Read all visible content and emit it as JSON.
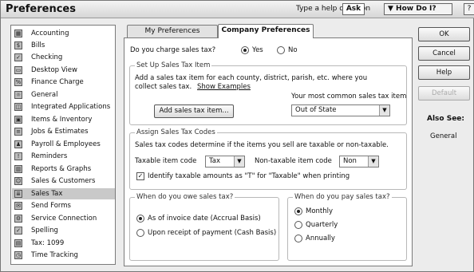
{
  "window": {
    "title": "Preferences",
    "help_question": "Type a help question",
    "ask_label": "Ask",
    "how_do_i_label": "▼ How Do I?",
    "close_label": "?"
  },
  "sidebar": {
    "items": [
      {
        "label": "Accounting",
        "icon": "accounting-icon",
        "selected": false
      },
      {
        "label": "Bills",
        "icon": "bills-icon",
        "selected": false
      },
      {
        "label": "Checking",
        "icon": "checking-icon",
        "selected": false
      },
      {
        "label": "Desktop View",
        "icon": "desktop-view-icon",
        "selected": false
      },
      {
        "label": "Finance Charge",
        "icon": "finance-charge-icon",
        "selected": false
      },
      {
        "label": "General",
        "icon": "general-icon",
        "selected": false
      },
      {
        "label": "Integrated Applications",
        "icon": "integrated-applications-icon",
        "selected": false
      },
      {
        "label": "Items & Inventory",
        "icon": "items-inventory-icon",
        "selected": false
      },
      {
        "label": "Jobs & Estimates",
        "icon": "jobs-estimates-icon",
        "selected": false
      },
      {
        "label": "Payroll & Employees",
        "icon": "payroll-employees-icon",
        "selected": false
      },
      {
        "label": "Reminders",
        "icon": "reminders-icon",
        "selected": false
      },
      {
        "label": "Reports & Graphs",
        "icon": "reports-graphs-icon",
        "selected": false
      },
      {
        "label": "Sales & Customers",
        "icon": "sales-customers-icon",
        "selected": false
      },
      {
        "label": "Sales Tax",
        "icon": "sales-tax-icon",
        "selected": true
      },
      {
        "label": "Send Forms",
        "icon": "send-forms-icon",
        "selected": false
      },
      {
        "label": "Service Connection",
        "icon": "service-connection-icon",
        "selected": false
      },
      {
        "label": "Spelling",
        "icon": "spelling-icon",
        "selected": false
      },
      {
        "label": "Tax: 1099",
        "icon": "tax-1099-icon",
        "selected": false
      },
      {
        "label": "Time Tracking",
        "icon": "time-tracking-icon",
        "selected": false
      }
    ]
  },
  "tabs": {
    "my_preferences": "My Preferences",
    "company_preferences": "Company Preferences"
  },
  "sales_tax": {
    "charge_question": "Do you charge sales tax?",
    "yes_label": "Yes",
    "no_label": "No",
    "charge_value": "Yes",
    "setup_group_title": "Set Up Sales Tax Item",
    "setup_desc_line1": "Add a sales tax item for each county, district, parish, etc. where you",
    "setup_desc_line2": "collect sales tax.",
    "show_examples_link": "Show Examples",
    "common_item_label": "Your most common sales tax item",
    "add_item_button": "Add sales tax item...",
    "common_item_value": "Out of State",
    "assign_group_title": "Assign Sales Tax Codes",
    "assign_desc": "Sales tax codes determine if the items you sell are taxable or non-taxable.",
    "taxable_code_label": "Taxable item code",
    "taxable_code_value": "Tax",
    "nontaxable_code_label": "Non-taxable item code",
    "nontaxable_code_value": "Non",
    "identify_checkbox_label": "Identify taxable amounts as \"T\" for \"Taxable\" when printing",
    "identify_checked": true,
    "owe_group_title": "When do you owe sales tax?",
    "owe_options": [
      "As of invoice date (Accrual Basis)",
      "Upon receipt of payment (Cash Basis)"
    ],
    "owe_selected": 0,
    "pay_group_title": "When do you pay sales tax?",
    "pay_options": [
      "Monthly",
      "Quarterly",
      "Annually"
    ],
    "pay_selected": 0
  },
  "right_buttons": {
    "ok": "OK",
    "cancel": "Cancel",
    "help": "Help",
    "default": "Default",
    "also_see_label": "Also See:",
    "general_link": "General"
  }
}
